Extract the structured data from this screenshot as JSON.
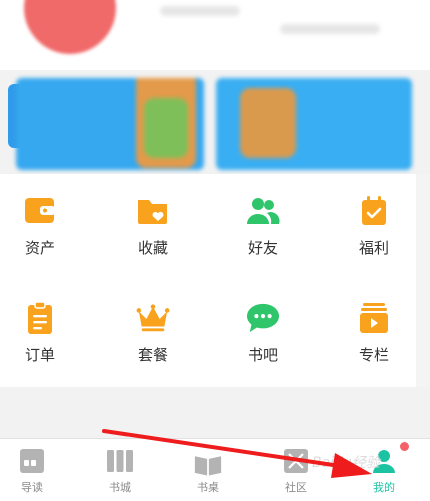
{
  "colors": {
    "accent_orange": "#f8a21d",
    "accent_green": "#2fc56a",
    "tab_active": "#1cc3a3",
    "tab_inactive": "#8a8a8a",
    "arrow_red": "#ee1c1c",
    "badge_red": "#f5616a"
  },
  "menu": {
    "items": [
      {
        "label": "资产",
        "icon": "wallet-icon"
      },
      {
        "label": "收藏",
        "icon": "favorite-folder-icon"
      },
      {
        "label": "好友",
        "icon": "friends-icon"
      },
      {
        "label": "福利",
        "icon": "welfare-check-icon"
      },
      {
        "label": "订单",
        "icon": "order-clipboard-icon"
      },
      {
        "label": "套餐",
        "icon": "crown-icon"
      },
      {
        "label": "书吧",
        "icon": "chat-bubble-icon"
      },
      {
        "label": "专栏",
        "icon": "column-play-icon"
      }
    ]
  },
  "tabbar": {
    "tabs": [
      {
        "label": "导读",
        "icon": "guide-icon"
      },
      {
        "label": "书城",
        "icon": "bookstore-icon"
      },
      {
        "label": "书桌",
        "icon": "desk-book-icon"
      },
      {
        "label": "社区",
        "icon": "community-icon"
      },
      {
        "label": "我的",
        "icon": "profile-icon",
        "active": true
      }
    ]
  },
  "watermark": {
    "text": "Baidu经验"
  }
}
